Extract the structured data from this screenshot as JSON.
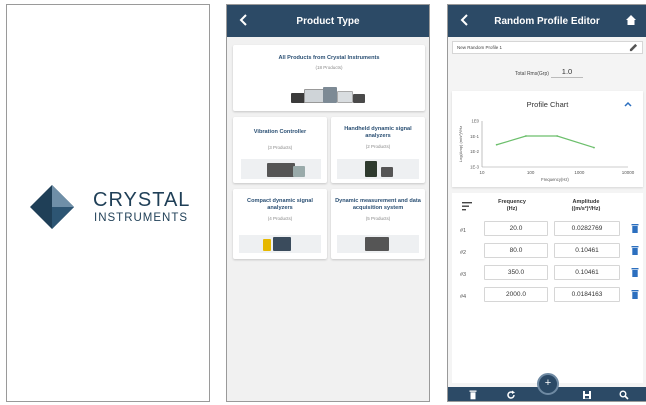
{
  "splash": {
    "brand_line1": "CRYSTAL",
    "brand_line2": "INSTRUMENTS",
    "colors": {
      "logo_dark": "#1f3f57",
      "logo_light": "#6f8fa8"
    }
  },
  "product_type": {
    "header_title": "Product Type",
    "back_icon": "chevron-left-icon",
    "cards": [
      {
        "title": "All Products from Crystal Instruments",
        "count": "(18 Products)"
      },
      {
        "title": "Vibration Controller",
        "count": "(3 Products)"
      },
      {
        "title": "Handheld dynamic signal analyzers",
        "count": "(2 Products)"
      },
      {
        "title": "Compact dynamic signal analyzers",
        "count": "(4 Products)"
      },
      {
        "title": "Dynamic measurement and data acquisition system",
        "count": "(5 Products)"
      }
    ]
  },
  "editor": {
    "header_title": "Random Profile Editor",
    "back_icon": "chevron-left-icon",
    "home_icon": "home-icon",
    "profile_name": "New Random Profile 1",
    "trms_label": "Total Rms(Grp)",
    "trms_value": "1.0",
    "chart_title": "Profile Chart",
    "table": {
      "col_frequency": "Frequency (Hz)",
      "col_amplitude": "Amplitude ((m/s²)²/Hz)",
      "rows": [
        {
          "label": "#1",
          "frequency": "20.0",
          "amplitude": "0.0282769"
        },
        {
          "label": "#2",
          "frequency": "80.0",
          "amplitude": "0.10461"
        },
        {
          "label": "#3",
          "frequency": "350.0",
          "amplitude": "0.10461"
        },
        {
          "label": "#4",
          "frequency": "2000.0",
          "amplitude": "0.0184163"
        }
      ]
    },
    "fab_label": "+",
    "bottom_icons": [
      "delete-icon",
      "refresh-icon",
      "save-icon",
      "search-icon"
    ],
    "colors": {
      "header": "#2c4a66",
      "line": "#6cbf6c"
    }
  },
  "chart_data": {
    "type": "line",
    "title": "Profile Chart",
    "xlabel": "Frequency(Hz)",
    "ylabel": "Log(Amp) (m/s²)²/Hz",
    "x_scale": "log",
    "y_scale": "log",
    "xlim": [
      10,
      10000
    ],
    "ylim": [
      0.001,
      1
    ],
    "x_ticks": [
      "10",
      "100",
      "1000",
      "10000"
    ],
    "y_ticks": [
      "1E0",
      "1E-1",
      "1E-2",
      "1E-3"
    ],
    "series": [
      {
        "x": [
          20,
          80,
          350,
          2000
        ],
        "y": [
          0.0282769,
          0.10461,
          0.10461,
          0.0184163
        ]
      }
    ],
    "grid": false
  }
}
